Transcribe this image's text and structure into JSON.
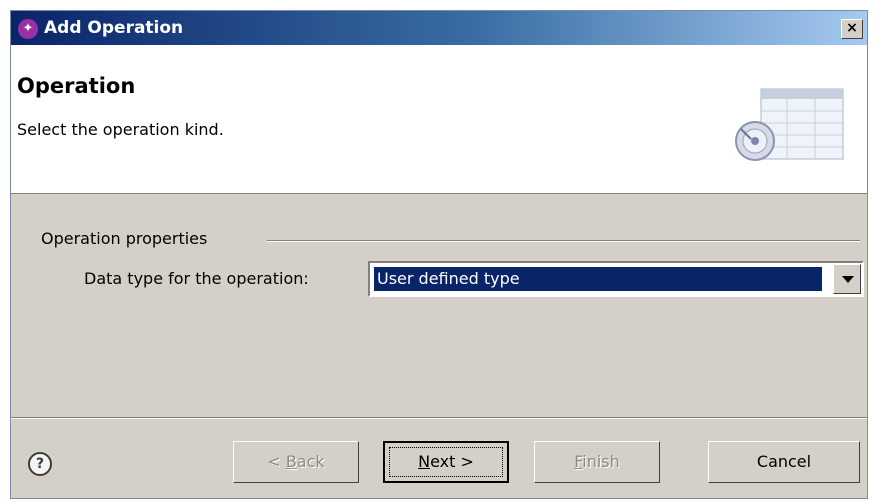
{
  "window": {
    "title": "Add Operation",
    "close_glyph": "×",
    "app_icon": "wizard-app-icon"
  },
  "header": {
    "title": "Operation",
    "description": "Select the operation kind."
  },
  "group": {
    "label": "Operation properties",
    "field_label": "Data type for the operation:",
    "selected_value": "User defined type"
  },
  "buttons": {
    "back": {
      "mnemonic": "B",
      "pre": "< ",
      "post": "ack",
      "enabled": false
    },
    "next": {
      "mnemonic": "N",
      "pre": "",
      "post": "ext >",
      "enabled": true
    },
    "finish": {
      "mnemonic": "F",
      "pre": "",
      "post": "inish",
      "enabled": false
    },
    "cancel": {
      "label": "Cancel",
      "enabled": true
    }
  },
  "help": {
    "glyph": "?"
  },
  "colors": {
    "title_bar": "#0a246a",
    "selection": "#0a246a",
    "dialog_bg": "#d4d0c8"
  }
}
